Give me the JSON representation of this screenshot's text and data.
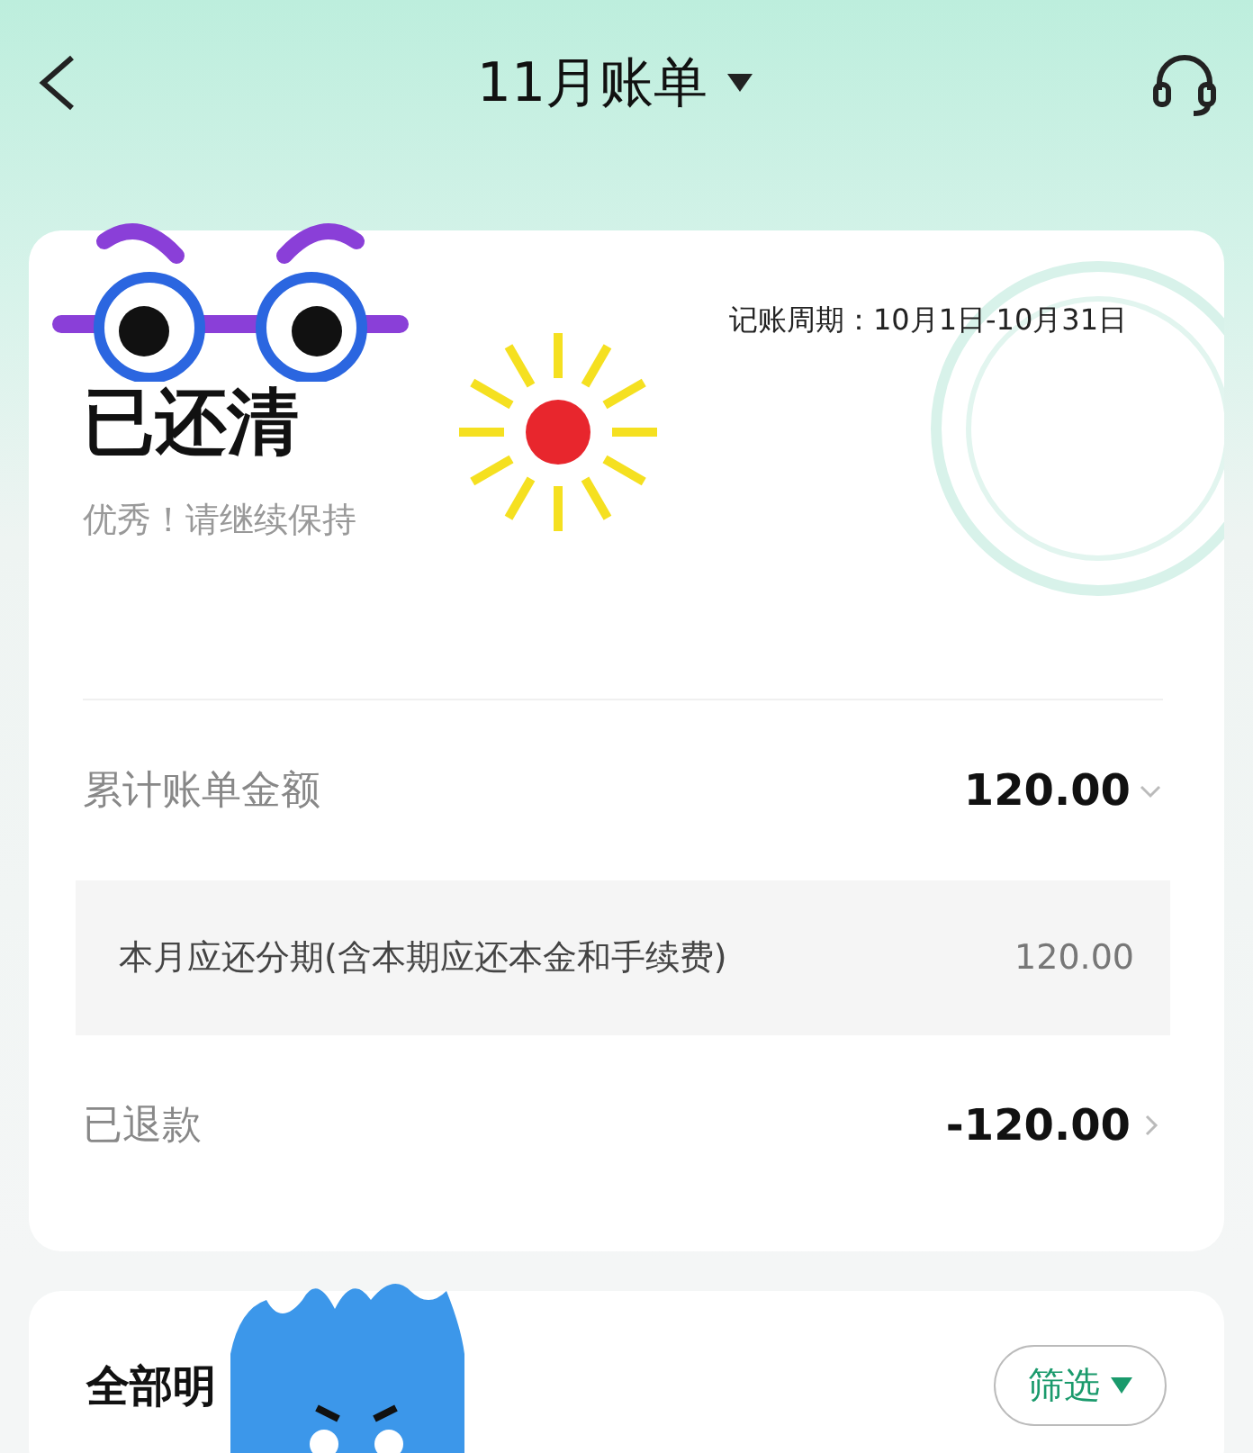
{
  "header": {
    "title": "11月账单"
  },
  "summary": {
    "period": "记账周期：10月1日-10月31日",
    "status": "已还清",
    "message": "优秀！请继续保持"
  },
  "rows": [
    {
      "kind": "total",
      "label": "累计账单金额",
      "amount": "120.00",
      "expanded": true
    },
    {
      "kind": "detail",
      "label": "本月应还分期(含本期应还本金和手续费)",
      "amount": "120.00"
    },
    {
      "kind": "link",
      "label": "已退款",
      "amount": "-120.00"
    }
  ],
  "details": {
    "title": "全部明",
    "filter": "筛选"
  }
}
